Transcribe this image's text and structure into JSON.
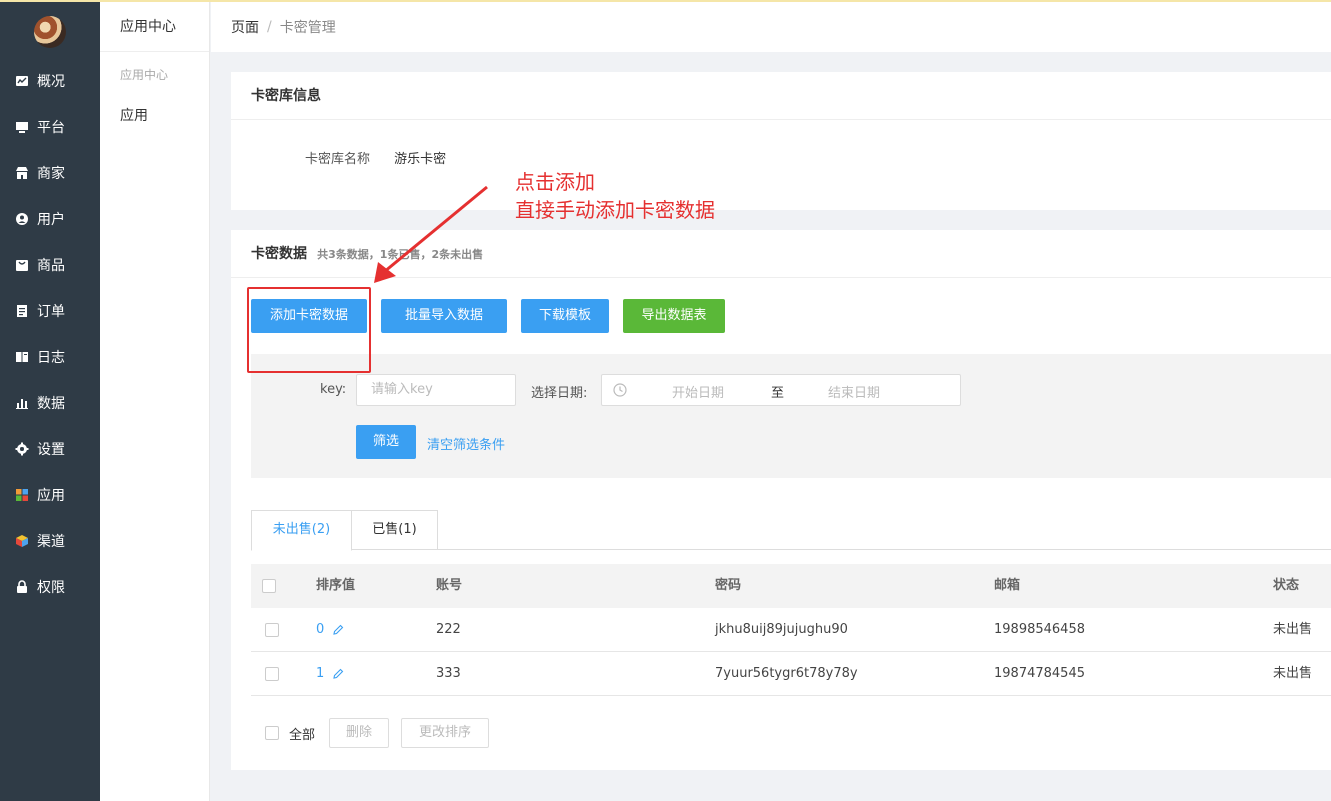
{
  "nav": {
    "items": [
      {
        "label": "概况",
        "icon": "chart-icon"
      },
      {
        "label": "平台",
        "icon": "monitor-icon"
      },
      {
        "label": "商家",
        "icon": "store-icon"
      },
      {
        "label": "用户",
        "icon": "user-icon"
      },
      {
        "label": "商品",
        "icon": "bag-icon"
      },
      {
        "label": "订单",
        "icon": "clipboard-icon"
      },
      {
        "label": "日志",
        "icon": "book-icon"
      },
      {
        "label": "数据",
        "icon": "bar-chart-icon"
      },
      {
        "label": "设置",
        "icon": "gear-icon"
      },
      {
        "label": "应用",
        "icon": "apps-grid-icon"
      },
      {
        "label": "渠道",
        "icon": "cube-icon"
      },
      {
        "label": "权限",
        "icon": "lock-icon"
      }
    ]
  },
  "submenu": {
    "header": "应用中心",
    "group": "应用中心",
    "item": "应用"
  },
  "breadcrumb": {
    "root": "页面",
    "sep": "/",
    "current": "卡密管理"
  },
  "info_card": {
    "title": "卡密库信息",
    "name_label": "卡密库名称",
    "name_value": "游乐卡密"
  },
  "data_card": {
    "title": "卡密数据",
    "summary": "共3条数据，1条已售，2条未出售",
    "buttons": {
      "add": "添加卡密数据",
      "import": "批量导入数据",
      "template": "下载模板",
      "export": "导出数据表"
    }
  },
  "filter": {
    "key_label": "key:",
    "key_placeholder": "请输入key",
    "date_label": "选择日期:",
    "start_placeholder": "开始日期",
    "to": "至",
    "end_placeholder": "结束日期",
    "filter_button": "筛选",
    "clear_link": "清空筛选条件"
  },
  "tabs": {
    "unsold": "未出售(2)",
    "sold": "已售(1)"
  },
  "table": {
    "headers": {
      "sort": "排序值",
      "account": "账号",
      "password": "密码",
      "email": "邮箱",
      "status": "状态"
    },
    "rows": [
      {
        "sort": "0",
        "account": "222",
        "password": "jkhu8uij89jujughu90",
        "email": "19898546458",
        "status": "未出售"
      },
      {
        "sort": "1",
        "account": "333",
        "password": "7yuur56tygr6t78y78y",
        "email": "19874784545",
        "status": "未出售"
      }
    ]
  },
  "bulk": {
    "all": "全部",
    "delete": "删除",
    "reorder": "更改排序"
  },
  "annotation": {
    "line1": "点击添加",
    "line2": "直接手动添加卡密数据",
    "color": "#e53030"
  },
  "colors": {
    "sidebar": "#2f3b46",
    "primary": "#3a9ff2",
    "success": "#5ab838"
  }
}
